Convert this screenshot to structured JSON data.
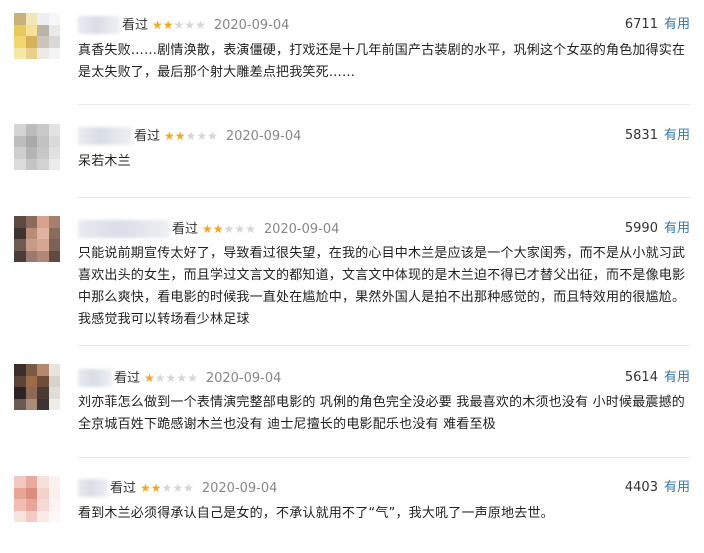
{
  "reviews": [
    {
      "watched_label": "看过",
      "rating_stars": 2,
      "date": "2020-09-04",
      "votes": "6711",
      "useful_label": "有用",
      "text": "真香失败……剧情涣散，表演僵硬，打戏还是十几年前国产古装剧的水平，巩俐这个女巫的角色加得实在是太失败了，最后那个射大雕差点把我笑死……",
      "avatar_colors": [
        "#c8b07a",
        "#f1e6b8",
        "#eeeef0",
        "#f7f7f7",
        "#e7c95c",
        "#f4e29a",
        "#b9b4a6",
        "#e9e9ea",
        "#f2d66e",
        "#d7b25a",
        "#c9c5bc",
        "#d8d8d8",
        "#f5e7a8",
        "#e9d08d",
        "#eceae3",
        "#f3f3f3"
      ]
    },
    {
      "watched_label": "看过",
      "rating_stars": 2,
      "date": "2020-09-04",
      "votes": "5831",
      "useful_label": "有用",
      "text": "呆若木兰",
      "avatar_colors": [
        "#d4d4d4",
        "#bcbcbc",
        "#c9c9c9",
        "#e3e3e3",
        "#bdbdbd",
        "#a9a9a9",
        "#c2c2c2",
        "#dadada",
        "#cfcfcf",
        "#b4b4b4",
        "#c7c7c7",
        "#e1e1e1",
        "#dcdcdc",
        "#c5c5c5",
        "#d2d2d2",
        "#ececec"
      ]
    },
    {
      "watched_label": "看过",
      "rating_stars": 2,
      "date": "2020-09-04",
      "votes": "5990",
      "useful_label": "有用",
      "text": "只能说前期宣传太好了，导致看过很失望，在我的心目中木兰是应该是一个大家闺秀，而不是从小就习武喜欢出头的女生，而且学过文言文的都知道，文言文中体现的是木兰迫不得已才替父出征，而不是像电影中那么爽快，看电影的时候我一直处在尴尬中，果然外国人是拍不出那种感觉的，而且特效用的很尴尬。我感觉我可以转场看少林足球",
      "avatar_colors": [
        "#5a4a42",
        "#8c6a5c",
        "#d9a28e",
        "#a67f70",
        "#3f3431",
        "#b98c78",
        "#e0b3a1",
        "#8a6b60",
        "#6f5b54",
        "#c79a86",
        "#d6a692",
        "#7d6158",
        "#4c3d38",
        "#9a7a6d",
        "#b28675",
        "#5e4a43"
      ]
    },
    {
      "watched_label": "看过",
      "rating_stars": 1,
      "date": "2020-09-04",
      "votes": "5614",
      "useful_label": "有用",
      "text": "刘亦菲怎么做到一个表情演完整部电影的 巩俐的角色完全没必要 我最喜欢的木须也没有 小时候最震撼的全京城百姓下跪感谢木兰也没有 迪士尼擅长的电影配乐也没有 难看至极",
      "avatar_colors": [
        "#3b2e2a",
        "#7b5a44",
        "#b48a6a",
        "#e8e3de",
        "#5a4538",
        "#9c6b48",
        "#6f4d38",
        "#d9d2cc",
        "#2d2523",
        "#8d6a55",
        "#4a3a33",
        "#e1dcd6",
        "#6a5a52",
        "#a88b78",
        "#3e3330",
        "#f0ece8"
      ]
    },
    {
      "watched_label": "看过",
      "rating_stars": 2,
      "date": "2020-09-04",
      "votes": "4403",
      "useful_label": "有用",
      "text": "看到木兰必须得承认自己是女的，不承认就用不了“气”，我大吼了一声原地去世。",
      "avatar_colors": [
        "#f2c9c0",
        "#e9aaa0",
        "#f6e0da",
        "#fbf2ef",
        "#e8a595",
        "#d98e82",
        "#f3d2cb",
        "#faf0ed",
        "#f0bdb2",
        "#e6a69b",
        "#f5d9d2",
        "#fcf4f2",
        "#f7e3de",
        "#f1cbc3",
        "#fae9e5",
        "#fdf8f7"
      ]
    }
  ]
}
